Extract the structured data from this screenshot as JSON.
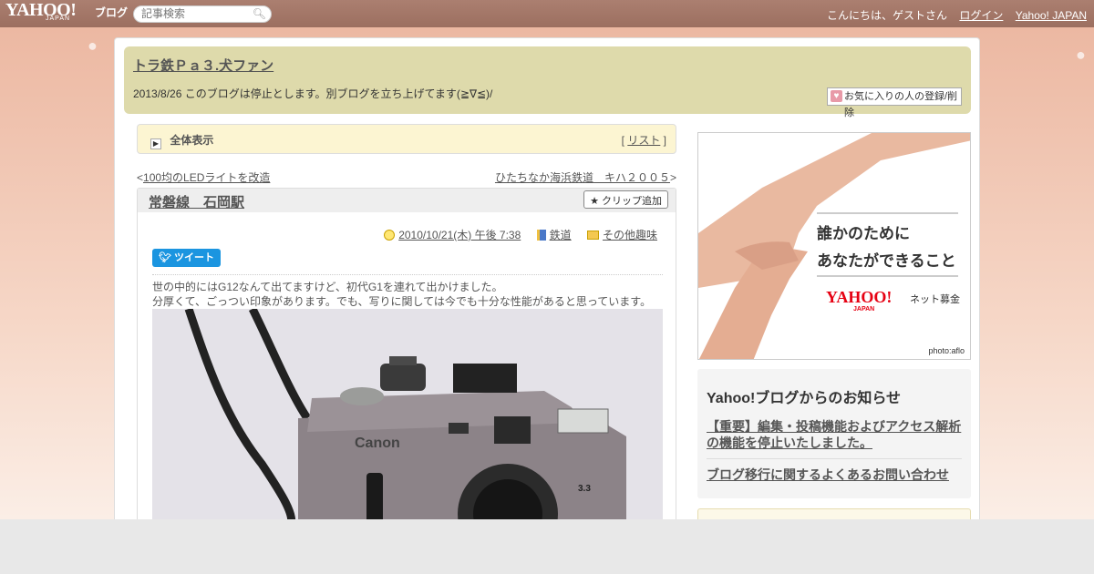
{
  "topbar": {
    "logo": "YAHOO!",
    "logo_sub": "JAPAN",
    "logo_blog": "ブログ",
    "search_placeholder": "記事検索",
    "greeting": "こんにちは、ゲストさん",
    "login": "ログイン",
    "yahoo_japan": "Yahoo! JAPAN"
  },
  "header": {
    "title": "トラ鉄Ｐａ３.犬ファン",
    "description": "2013/8/26 このブログは停止とします。別ブログを立ち上げてます(≧∇≦)/",
    "fav_button": "お気に入りの人の登録/削除"
  },
  "allview": {
    "label": "全体表示",
    "list_open": "[ ",
    "list_link": "リスト",
    "list_close": " ]"
  },
  "nav": {
    "prev_mark": "<",
    "prev": "100均のLEDライトを改造",
    "next": "ひたちなか海浜鉄道　キハ２００５",
    "next_mark": ">"
  },
  "article": {
    "title": "常磐線　石岡駅",
    "clip": "クリップ追加",
    "date": "2010/10/21(木) 午後 7:38",
    "category1": "鉄道",
    "category2": "その他趣味",
    "tweet": "ツイート",
    "text_line1": "世の中的にはG12なんて出てますけど、初代G1を連れて出かけました。",
    "text_line2": "分厚くて、ごっつい印象があります。でも、写りに関しては今でも十分な性能があると思っています。",
    "photo_brand": "Canon",
    "photo_mega": "3.3"
  },
  "ad": {
    "line1": "誰かのために",
    "line2": "あなたができること",
    "brand": "YAHOO!",
    "brand_sub": "JAPAN",
    "service": "ネット募金",
    "credit": "photo:aflo"
  },
  "notice": {
    "heading": "Yahoo!ブログからのお知らせ",
    "item1": "【重要】編集・投稿機能およびアクセス解析の機能を停止いたしました。",
    "item2": "ブログ移行に関するよくあるお問い合わせ"
  }
}
